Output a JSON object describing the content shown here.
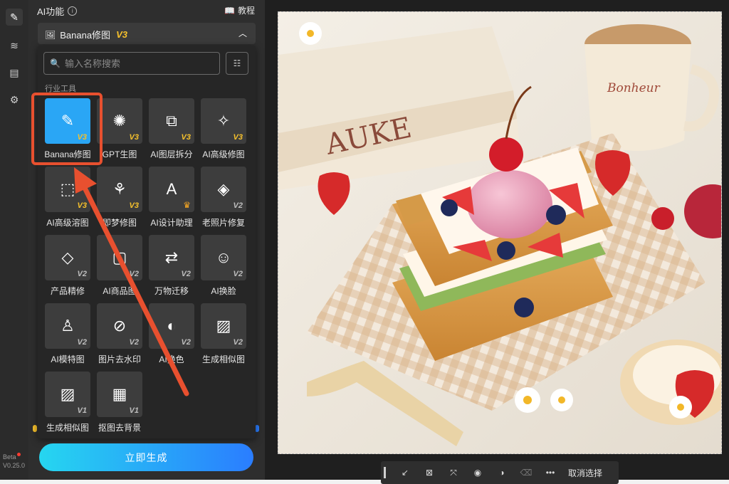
{
  "rail": {
    "items": [
      {
        "name": "pen-icon",
        "glyph": "✎"
      },
      {
        "name": "layers-icon",
        "glyph": "≋"
      },
      {
        "name": "clipboard-icon",
        "glyph": "▤"
      },
      {
        "name": "gear-icon",
        "glyph": "⚙"
      }
    ],
    "beta": "Beta",
    "version": "V0.25.0"
  },
  "panel": {
    "title": "AI功能",
    "info": "i",
    "tutorial": "教程",
    "model_name": "Banana修图",
    "model_version": "V3"
  },
  "popup": {
    "search_placeholder": "输入名称搜索",
    "section_label": "行业工具",
    "tools": [
      {
        "label": "Banana修图",
        "badge": "V3",
        "icon": "image-edit-icon",
        "glyph": "✎"
      },
      {
        "label": "GPT生图",
        "badge": "V3",
        "icon": "openai-icon",
        "glyph": "✺"
      },
      {
        "label": "AI图层拆分",
        "badge": "V3",
        "icon": "layer-split-icon",
        "glyph": "⧉"
      },
      {
        "label": "AI高级修图",
        "badge": "V3",
        "icon": "magic-wand-icon",
        "glyph": "✧"
      },
      {
        "label": "AI高级溶图",
        "badge": "V3",
        "icon": "image-sparkle-icon",
        "glyph": "⬚"
      },
      {
        "label": "即梦修图",
        "badge": "V3",
        "icon": "dream-icon",
        "glyph": "⚘"
      },
      {
        "label": "AI设计助理",
        "badge": "♛",
        "icon": "design-assistant-icon",
        "glyph": "A"
      },
      {
        "label": "老照片修复",
        "badge": "V2",
        "icon": "photo-restore-icon",
        "glyph": "◈"
      },
      {
        "label": "产品精修",
        "badge": "V2",
        "icon": "diamond-icon",
        "glyph": "◇"
      },
      {
        "label": "AI商品图",
        "badge": "V2",
        "icon": "product-image-icon",
        "glyph": "▢"
      },
      {
        "label": "万物迁移",
        "badge": "V2",
        "icon": "transfer-icon",
        "glyph": "⇄"
      },
      {
        "label": "AI换脸",
        "badge": "V2",
        "icon": "face-swap-icon",
        "glyph": "☺"
      },
      {
        "label": "AI模特图",
        "badge": "V2",
        "icon": "model-person-icon",
        "glyph": "♙"
      },
      {
        "label": "图片去水印",
        "badge": "V2",
        "icon": "remove-watermark-icon",
        "glyph": "⊘"
      },
      {
        "label": "AI换色",
        "badge": "V2",
        "icon": "recolor-icon",
        "glyph": "◐"
      },
      {
        "label": "生成相似图",
        "badge": "V2",
        "icon": "similar-image-icon",
        "glyph": "▨"
      },
      {
        "label": "生成相似图",
        "badge": "V1",
        "icon": "similar-image-v1-icon",
        "glyph": "▨"
      },
      {
        "label": "抠图去背景",
        "badge": "V1",
        "icon": "cutout-icon",
        "glyph": "▦"
      }
    ]
  },
  "generate_button": "立即生成",
  "toolbar": {
    "items": [
      {
        "name": "brush-select-icon",
        "glyph": "↙"
      },
      {
        "name": "smart-select-icon",
        "glyph": "⊠"
      },
      {
        "name": "expand-select-icon",
        "glyph": "⤧"
      },
      {
        "name": "mask-icon",
        "glyph": "◉"
      },
      {
        "name": "contrast-icon",
        "glyph": "◑"
      },
      {
        "name": "eraser-icon",
        "glyph": "⌫"
      },
      {
        "name": "more-icon",
        "glyph": "•••"
      }
    ],
    "cancel_select": "取消选择"
  },
  "photo_text": {
    "book_spine": "AUKE",
    "cup_brand": "Bonheur"
  }
}
